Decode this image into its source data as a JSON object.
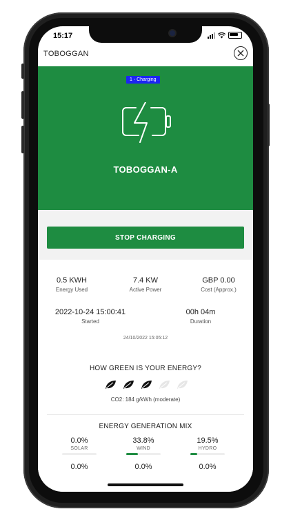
{
  "status_bar": {
    "time": "15:17"
  },
  "header": {
    "title": "TOBOGGAN"
  },
  "hero": {
    "badge": "1 - Charging",
    "charger_name": "TOBOGGAN-A",
    "icon": "battery-charging-icon"
  },
  "actions": {
    "stop_label": "STOP CHARGING"
  },
  "stats": {
    "energy_used": {
      "value": "0.5 KWH",
      "label": "Energy Used"
    },
    "active_power": {
      "value": "7.4 KW",
      "label": "Active Power"
    },
    "cost": {
      "value": "GBP 0.00",
      "label": "Cost (Approx.)"
    },
    "started": {
      "value": "2022-10-24 15:00:41",
      "label": "Started"
    },
    "duration": {
      "value": "00h 04m",
      "label": "Duration"
    },
    "timestamp": "24/10/2022 15:05:12"
  },
  "green_energy": {
    "title": "HOW GREEN IS YOUR ENERGY?",
    "rating": 3,
    "max_rating": 5,
    "co2": "CO2: 184 g/kWh  (moderate)"
  },
  "generation_mix": {
    "title": "ENERGY GENERATION MIX",
    "sources": [
      {
        "percent": "0.0%",
        "name": "SOLAR",
        "fraction": 0.0,
        "lower": "0.0%"
      },
      {
        "percent": "33.8%",
        "name": "WIND",
        "fraction": 0.338,
        "lower": "0.0%"
      },
      {
        "percent": "19.5%",
        "name": "HYDRO",
        "fraction": 0.195,
        "lower": "0.0%"
      }
    ]
  },
  "colors": {
    "brand_green": "#1e8c41",
    "badge_blue": "#1c25f2"
  }
}
